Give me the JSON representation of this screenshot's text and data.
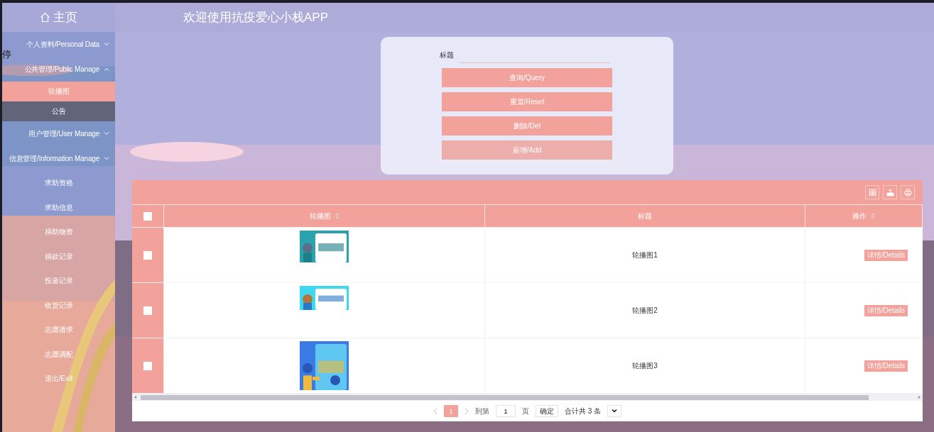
{
  "overlay_text": "停",
  "sidebar": {
    "home": "主页",
    "items": [
      {
        "kind": "group",
        "label": "个人资料/Personal Data",
        "expanded": false
      },
      {
        "kind": "group",
        "label": "公共管理/Public Manage",
        "expanded": true,
        "children": [
          {
            "label": "轮播图",
            "selected": true
          },
          {
            "label": "公告",
            "selected": false
          }
        ]
      },
      {
        "kind": "group",
        "label": "用户管理/User Manage",
        "expanded": false
      },
      {
        "kind": "group",
        "label": "信息管理/Information Manage",
        "expanded": false
      },
      {
        "kind": "item",
        "label": "求助资格"
      },
      {
        "kind": "item",
        "label": "求助信息"
      },
      {
        "kind": "item",
        "label": "捐助物资"
      },
      {
        "kind": "item",
        "label": "捐款记录"
      },
      {
        "kind": "item",
        "label": "投递记录"
      },
      {
        "kind": "item",
        "label": "收货记录"
      },
      {
        "kind": "item",
        "label": "志愿请求"
      },
      {
        "kind": "item",
        "label": "志愿调配"
      },
      {
        "kind": "item",
        "label": "退出/Exit"
      }
    ]
  },
  "header": {
    "title": "欢迎使用抗疫爱心小栈APP"
  },
  "search": {
    "label": "标题",
    "buttons": [
      {
        "label": "查询/Query",
        "hovered": false
      },
      {
        "label": "重置/Reset",
        "hovered": false
      },
      {
        "label": "删除/Del",
        "hovered": false
      },
      {
        "label": "新增/Add",
        "hovered": true
      }
    ]
  },
  "table": {
    "select_all": {
      "checked": false
    },
    "columns": [
      {
        "label": "轮播图",
        "sortable": true
      },
      {
        "label": "标题",
        "sortable": false
      },
      {
        "label": "操作",
        "sortable": true
      }
    ],
    "rows": [
      {
        "checked": false,
        "title": "轮播图1",
        "action": "详情/Details"
      },
      {
        "checked": false,
        "title": "轮播图2",
        "action": "详情/Details"
      },
      {
        "checked": false,
        "title": "轮播图3",
        "action": "详情/Details"
      }
    ]
  },
  "pagination": {
    "pages": [
      {
        "label": "1",
        "selected": true
      }
    ],
    "goto_label": "到第",
    "goto_value": "1",
    "page_unit": "页",
    "confirm": "确定",
    "total": "合计共 3 条"
  }
}
